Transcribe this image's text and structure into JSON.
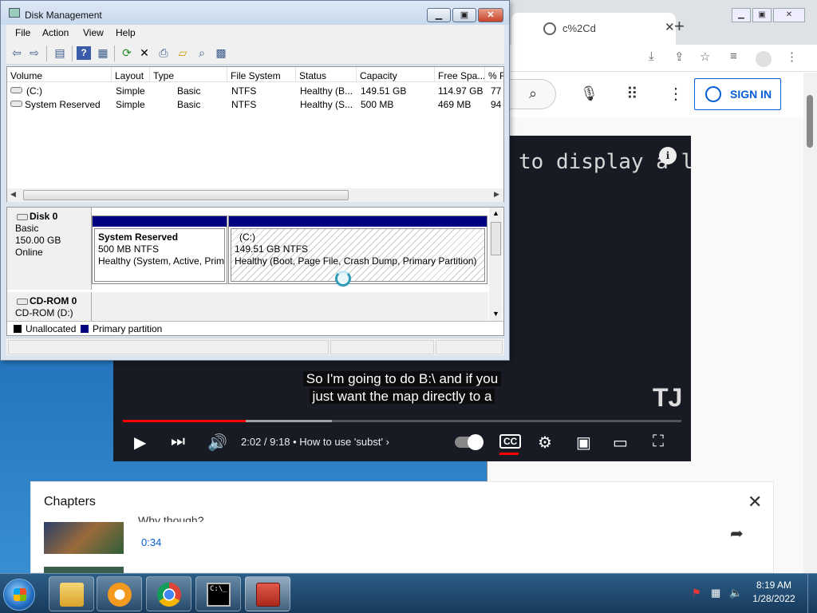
{
  "chrome": {
    "tab_title": "c%2Cd",
    "sign_in": "SIGN IN",
    "icons": [
      "globe-icon",
      "close-icon",
      "new-tab-icon",
      "install-icon",
      "share-icon",
      "bookmark-star-icon",
      "media-icon",
      "profile-icon",
      "menu-dots-icon",
      "search-icon",
      "mic-icon",
      "apps-icon",
      "more-icon"
    ]
  },
  "video": {
    "code_line": "to display a l",
    "caption_line1": "So I'm going to do B:\\ and if you",
    "caption_line2": "just want the map directly to a",
    "watermark": "TJ",
    "time": "2:02 / 9:18",
    "chapter_name": "How to use 'subst'",
    "chapter_chevron": "›",
    "progress_fraction": 0.22,
    "colors": {
      "progress": "#ff0000",
      "background": "#191b24"
    }
  },
  "chapters": {
    "title": "Chapters",
    "item_title": "Why though?",
    "item_time": "0:34"
  },
  "disk_mgmt": {
    "title": "Disk Management",
    "menu": [
      "File",
      "Action",
      "View",
      "Help"
    ],
    "columns": [
      "Volume",
      "Layout",
      "Type",
      "File System",
      "Status",
      "Capacity",
      "Free Spa...",
      "% F"
    ],
    "rows": [
      [
        "(C:)",
        "Simple",
        "Basic",
        "NTFS",
        "Healthy (B...",
        "149.51 GB",
        "114.97 GB",
        "77"
      ],
      [
        "System Reserved",
        "Simple",
        "Basic",
        "NTFS",
        "Healthy (S...",
        "500 MB",
        "469 MB",
        "94"
      ]
    ],
    "disk0": {
      "name": "Disk 0",
      "type": "Basic",
      "size": "150.00 GB",
      "state": "Online"
    },
    "partition_sys": {
      "name": "System Reserved",
      "size": "500 MB NTFS",
      "status": "Healthy (System, Active, Primary Partition)"
    },
    "partition_c": {
      "name": "(C:)",
      "size": "149.51 GB NTFS",
      "status": "Healthy (Boot, Page File, Crash Dump, Primary Partition)"
    },
    "cdrom": {
      "name": "CD-ROM 0",
      "drive": "CD-ROM (D:)"
    },
    "legend": [
      "Unallocated",
      "Primary partition"
    ],
    "colors": {
      "partition_header": "#000080",
      "unallocated": "#000000"
    }
  },
  "taskbar": {
    "apps": [
      "explorer",
      "media-player",
      "chrome",
      "command-prompt",
      "disk-management"
    ],
    "time": "8:19 AM",
    "date": "1/28/2022"
  }
}
